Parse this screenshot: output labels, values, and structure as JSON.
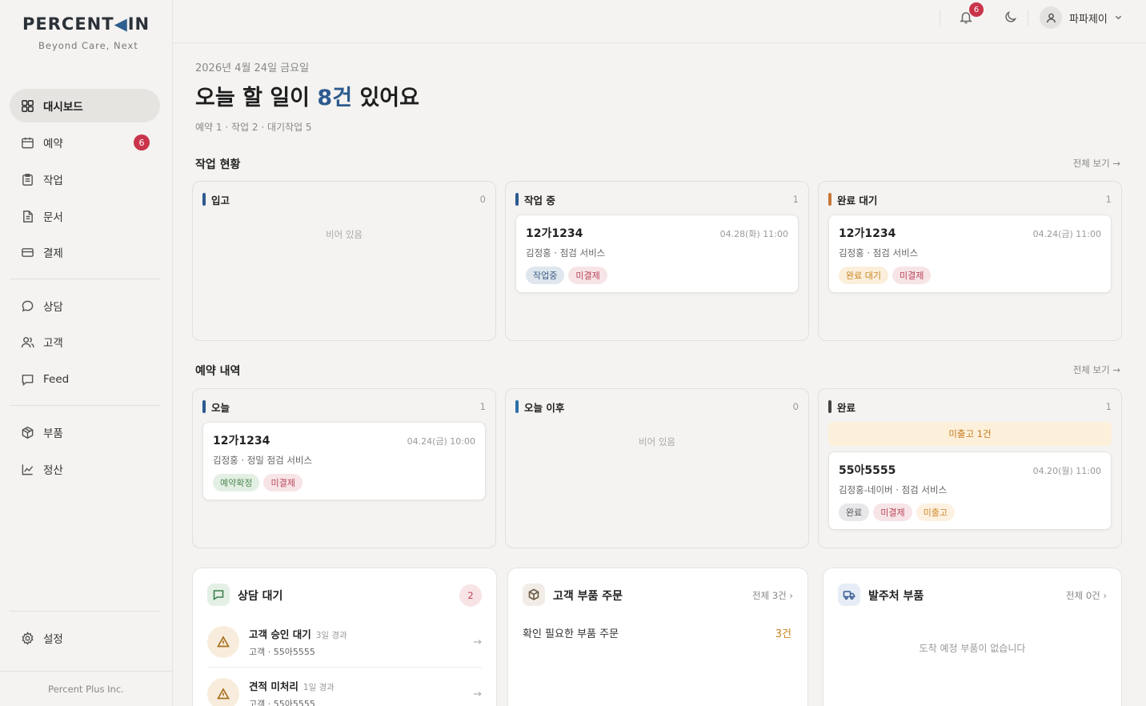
{
  "brand": {
    "name_prefix": "PERCENT",
    "name_suffix": "IN",
    "tagline": "Beyond Care, Next",
    "footer": "Percent Plus Inc."
  },
  "sidebar": {
    "items": [
      {
        "label": "대시보드",
        "icon": "dashboard-icon"
      },
      {
        "label": "예약",
        "icon": "calendar-icon",
        "badge": "6"
      },
      {
        "label": "작업",
        "icon": "clipboard-icon"
      },
      {
        "label": "문서",
        "icon": "document-icon"
      },
      {
        "label": "결제",
        "icon": "card-icon"
      },
      {
        "label": "상담",
        "icon": "chat-icon"
      },
      {
        "label": "고객",
        "icon": "users-icon"
      },
      {
        "label": "Feed",
        "icon": "feed-icon"
      },
      {
        "label": "부품",
        "icon": "box-icon"
      },
      {
        "label": "정산",
        "icon": "chart-line-icon"
      },
      {
        "label": "설정",
        "icon": "gear-icon"
      }
    ]
  },
  "topbar": {
    "notification_count": "6",
    "user_name": "파파제이"
  },
  "header": {
    "date": "2026년 4월 24일 금요일",
    "headline_prefix": "오늘 할 일이 ",
    "headline_count": "8건",
    "headline_suffix": " 있어요",
    "summary": "예약 1 · 작업 2 · 대기작업 5"
  },
  "work_status": {
    "title": "작업 현황",
    "see_all": "전체 보기 →",
    "columns": [
      {
        "label": "입고",
        "count": "0",
        "color": "#2d5a8e",
        "empty": "비어 있음"
      },
      {
        "label": "작업 중",
        "count": "1",
        "color": "#2d5a8e",
        "card": {
          "plate": "12가1234",
          "datetime": "04.28(화) 11:00",
          "desc": "김정홍 · 점검 서비스",
          "chips": [
            "작업중",
            "미결제"
          ]
        }
      },
      {
        "label": "완료 대기",
        "count": "1",
        "color": "#c8783a",
        "card": {
          "plate": "12가1234",
          "datetime": "04.24(금) 11:00",
          "desc": "김정홍 · 점검 서비스",
          "chips": [
            "완료 대기",
            "미결제"
          ]
        }
      }
    ]
  },
  "reservations": {
    "title": "예약 내역",
    "see_all": "전체 보기 →",
    "columns": [
      {
        "label": "오늘",
        "count": "1",
        "color": "#2d5a8e",
        "card": {
          "plate": "12가1234",
          "datetime": "04.24(금) 10:00",
          "desc": "김정홍 · 정밀 점검 서비스",
          "chips": [
            "예약확정",
            "미결제"
          ]
        }
      },
      {
        "label": "오늘 이후",
        "count": "0",
        "color": "#2d6ea8",
        "empty": "비어 있음"
      },
      {
        "label": "완료",
        "count": "1",
        "color": "#444",
        "notice": "미출고 1건",
        "card": {
          "plate": "55아5555",
          "datetime": "04.20(월) 11:00",
          "desc": "김정홍-네이버 · 점검 서비스",
          "chips": [
            "완료",
            "미결제",
            "미출고"
          ]
        }
      }
    ]
  },
  "consult": {
    "title": "상담 대기",
    "badge": "2",
    "rows": [
      {
        "title": "고객 승인 대기",
        "ago": "3일 경과",
        "sub": "고객 · 55아5555"
      },
      {
        "title": "견적 미처리",
        "ago": "1일 경과",
        "sub": "고객 · 55아5555"
      }
    ]
  },
  "parts_orders": {
    "title": "고객 부품 주문",
    "link": "전체 3건 ›",
    "row_label": "확인 필요한 부품 주문",
    "row_value": "3건"
  },
  "supplier_parts": {
    "title": "발주처 부품",
    "link": "전체 0건 ›",
    "empty": "도착 예정 부품이 없습니다"
  }
}
